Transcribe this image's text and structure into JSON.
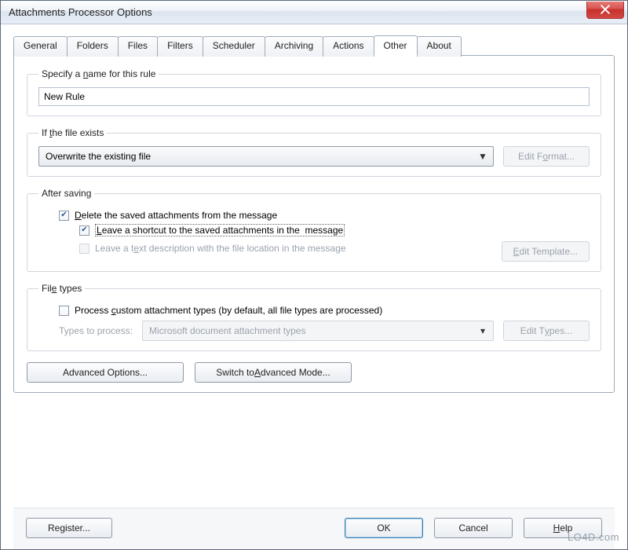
{
  "window": {
    "title": "Attachments Processor Options"
  },
  "tabs": [
    "General",
    "Folders",
    "Files",
    "Filters",
    "Scheduler",
    "Archiving",
    "Actions",
    "Other",
    "About"
  ],
  "active_tab": "Other",
  "rule_name": {
    "legend": "Specify a name for this rule",
    "value": "New Rule"
  },
  "file_exists": {
    "legend": "If the file exists",
    "selected": "Overwrite the existing file",
    "edit_format_btn": "Edit Format..."
  },
  "after_saving": {
    "legend": "After saving",
    "delete_label": "Delete the saved attachments from the message",
    "delete_checked": true,
    "shortcut_label": "Leave a shortcut to the saved attachments in the  message",
    "shortcut_checked": true,
    "textdesc_label": "Leave a text description with the file location in the message",
    "textdesc_checked": false,
    "edit_template_btn": "Edit Template..."
  },
  "file_types": {
    "legend": "File types",
    "process_custom_label": "Process custom attachment types (by default, all file types are processed)",
    "process_custom_checked": false,
    "types_to_process_label": "Types to process:",
    "types_selected": "Microsoft document attachment types",
    "edit_types_btn": "Edit Types..."
  },
  "buttons": {
    "advanced_options": "Advanced Options...",
    "switch_advanced": "Switch to Advanced Mode...",
    "register": "Register...",
    "ok": "OK",
    "cancel": "Cancel",
    "help": "Help"
  },
  "watermark": "LO4D.com"
}
